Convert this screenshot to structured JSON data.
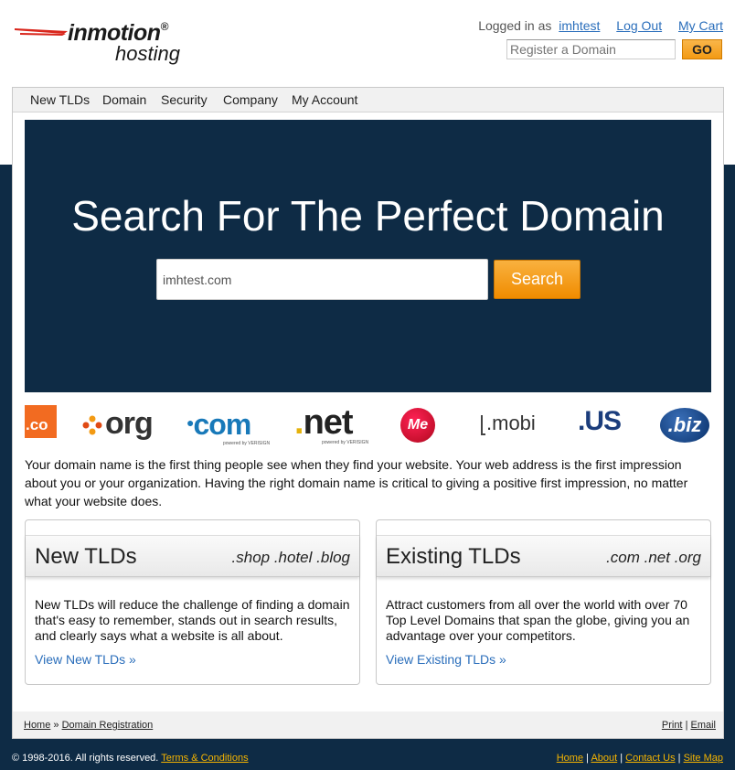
{
  "brand": {
    "logo_main": "inmotion",
    "logo_registered": "®",
    "logo_sub": "hosting"
  },
  "account": {
    "logged_in_prefix": "Logged in as",
    "username": "imhtest",
    "logout_label": "Log Out",
    "cart_label": "My Cart"
  },
  "register": {
    "placeholder": "Register a Domain",
    "go_label": "GO"
  },
  "nav": {
    "items": [
      {
        "label": "New TLDs"
      },
      {
        "label": "Domain"
      },
      {
        "label": "Security"
      },
      {
        "label": "Company"
      },
      {
        "label": "My Account"
      }
    ]
  },
  "hero": {
    "title": "Search For The Perfect Domain",
    "search_value": "imhtest.com",
    "search_button": "Search"
  },
  "tlds": {
    "co": ".co",
    "org": "org",
    "com": "com",
    "net_dot": ".",
    "net": "net",
    "powered": "powered by VERISIGN",
    "me": "Me",
    "mobi": ".mobi",
    "us": ".US",
    "biz": ".biz"
  },
  "intro": "Your domain name is the first thing people see when they find your website. Your web address is the first impression about you or your organization. Having the right domain name is critical to giving a positive first impression, no matter what your website does.",
  "cards": {
    "new": {
      "title": "New TLDs",
      "tags": ".shop .hotel .blog",
      "text": "New TLDs will reduce the challenge of finding a domain that's easy to remember, stands out in search results, and clearly says what a website is all about.",
      "link": "View New TLDs »"
    },
    "existing": {
      "title": "Existing TLDs",
      "tags": ".com .net .org",
      "text": "Attract customers from all over the world with over 70 Top Level Domains that span the globe, giving you an advantage over your competitors.",
      "link": "View Existing TLDs »"
    }
  },
  "breadcrumb": {
    "home": "Home",
    "separator": "»",
    "current": "Domain Registration"
  },
  "page_tools": {
    "print": "Print",
    "email": "Email",
    "separator": "|"
  },
  "footer": {
    "copyright": "© 1998-2016. All rights reserved.",
    "terms": "Terms & Conditions",
    "links": [
      "Home",
      "About",
      "Contact Us",
      "Site Map"
    ],
    "separator": "|"
  },
  "colors": {
    "navy": "#0e2b45",
    "orange": "#f39a13",
    "link_blue": "#2a6ebb",
    "footer_link": "#f5b400"
  }
}
